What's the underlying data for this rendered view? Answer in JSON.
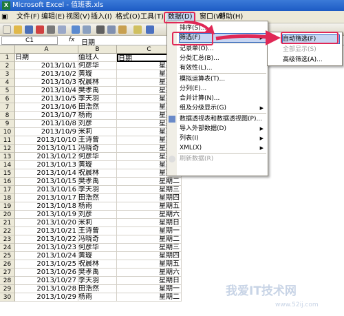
{
  "window": {
    "title": "Microsoft Excel - 值班表.xls"
  },
  "menu": {
    "items": [
      "文件(F)",
      "编辑(E)",
      "视图(V)",
      "插入(I)",
      "格式(O)",
      "工具(T)",
      "数据(D)",
      "窗口(W)",
      "帮助(H)"
    ]
  },
  "toolbar": {
    "font_name": "宋体",
    "undo_icon": "undo-icon"
  },
  "formula_bar": {
    "name_box": "C1",
    "fx_label": "fx",
    "value": "日期"
  },
  "columns": [
    "A",
    "B",
    "C"
  ],
  "header_row": {
    "a": "日期",
    "b": "值班人",
    "c": "日期"
  },
  "rows": [
    {
      "n": "2",
      "date": "2013/10/1",
      "name": "何彦华",
      "day": "星期二"
    },
    {
      "n": "3",
      "date": "2013/10/2",
      "name": "黄璇",
      "day": "星期三"
    },
    {
      "n": "4",
      "date": "2013/10/3",
      "name": "祝晨林",
      "day": "星期四"
    },
    {
      "n": "5",
      "date": "2013/10/4",
      "name": "樊孝禹",
      "day": "星期五"
    },
    {
      "n": "6",
      "date": "2013/10/5",
      "name": "李天羽",
      "day": "星期六"
    },
    {
      "n": "7",
      "date": "2013/10/6",
      "name": "田浩然",
      "day": "星期日"
    },
    {
      "n": "8",
      "date": "2013/10/7",
      "name": "杨雨",
      "day": "星期一"
    },
    {
      "n": "9",
      "date": "2013/10/8",
      "name": "刘彦",
      "day": "星期二"
    },
    {
      "n": "10",
      "date": "2013/10/9",
      "name": "米莉",
      "day": "星期三"
    },
    {
      "n": "11",
      "date": "2013/10/10",
      "name": "王诗曾",
      "day": "星期四"
    },
    {
      "n": "12",
      "date": "2013/10/11",
      "name": "冯晓奇",
      "day": "星期五"
    },
    {
      "n": "13",
      "date": "2013/10/12",
      "name": "何彦华",
      "day": "星期六"
    },
    {
      "n": "14",
      "date": "2013/10/13",
      "name": "黄璇",
      "day": "星期日"
    },
    {
      "n": "15",
      "date": "2013/10/14",
      "name": "祝晨林",
      "day": "星期一"
    },
    {
      "n": "16",
      "date": "2013/10/15",
      "name": "樊孝禹",
      "day": "星期二"
    },
    {
      "n": "17",
      "date": "2013/10/16",
      "name": "李天羽",
      "day": "星期三"
    },
    {
      "n": "18",
      "date": "2013/10/17",
      "name": "田浩然",
      "day": "星期四"
    },
    {
      "n": "19",
      "date": "2013/10/18",
      "name": "杨雨",
      "day": "星期五"
    },
    {
      "n": "20",
      "date": "2013/10/19",
      "name": "刘彦",
      "day": "星期六"
    },
    {
      "n": "21",
      "date": "2013/10/20",
      "name": "米莉",
      "day": "星期日"
    },
    {
      "n": "22",
      "date": "2013/10/21",
      "name": "王诗曾",
      "day": "星期一"
    },
    {
      "n": "23",
      "date": "2013/10/22",
      "name": "冯晓奇",
      "day": "星期二"
    },
    {
      "n": "24",
      "date": "2013/10/23",
      "name": "何彦华",
      "day": "星期三"
    },
    {
      "n": "25",
      "date": "2013/10/24",
      "name": "黄璇",
      "day": "星期四"
    },
    {
      "n": "26",
      "date": "2013/10/25",
      "name": "祝晨林",
      "day": "星期五"
    },
    {
      "n": "27",
      "date": "2013/10/26",
      "name": "樊孝禹",
      "day": "星期六"
    },
    {
      "n": "28",
      "date": "2013/10/27",
      "name": "李天羽",
      "day": "星期日"
    },
    {
      "n": "29",
      "date": "2013/10/28",
      "name": "田浩然",
      "day": "星期一"
    },
    {
      "n": "30",
      "date": "2013/10/29",
      "name": "杨雨",
      "day": "星期二"
    }
  ],
  "data_menu": {
    "items": [
      {
        "label": "排序(S)...",
        "has_sub": false,
        "disabled": false
      },
      {
        "label": "筛选(F)",
        "has_sub": true,
        "disabled": false
      },
      {
        "label": "记录单(O)...",
        "has_sub": false,
        "disabled": false
      },
      {
        "label": "分类汇总(B)...",
        "has_sub": false,
        "disabled": false
      },
      {
        "label": "有效性(L)...",
        "has_sub": false,
        "disabled": false
      },
      {
        "label": "模拟运算表(T)...",
        "has_sub": false,
        "disabled": false
      },
      {
        "label": "分列(E)...",
        "has_sub": false,
        "disabled": false
      },
      {
        "label": "合并计算(N)...",
        "has_sub": false,
        "disabled": false
      },
      {
        "label": "组及分级显示(G)",
        "has_sub": true,
        "disabled": false
      },
      {
        "label": "数据透视表和数据透视图(P)...",
        "has_sub": false,
        "disabled": false
      },
      {
        "label": "导入外部数据(D)",
        "has_sub": true,
        "disabled": false
      },
      {
        "label": "列表(I)",
        "has_sub": true,
        "disabled": false
      },
      {
        "label": "XML(X)",
        "has_sub": true,
        "disabled": false
      },
      {
        "label": "刷新数据(R)",
        "has_sub": false,
        "disabled": true
      }
    ]
  },
  "filter_submenu": {
    "items": [
      {
        "label": "自动筛选(F)",
        "disabled": false
      },
      {
        "label": "全部显示(S)",
        "disabled": true
      },
      {
        "label": "高级筛选(A)...",
        "disabled": false
      }
    ]
  },
  "watermark": {
    "text": "我爱IT技术网",
    "url": "www.52ij.com"
  },
  "colors": {
    "highlight": "#e02856",
    "title": "#1d5bc4",
    "menu_bg": "#ece9d8"
  }
}
